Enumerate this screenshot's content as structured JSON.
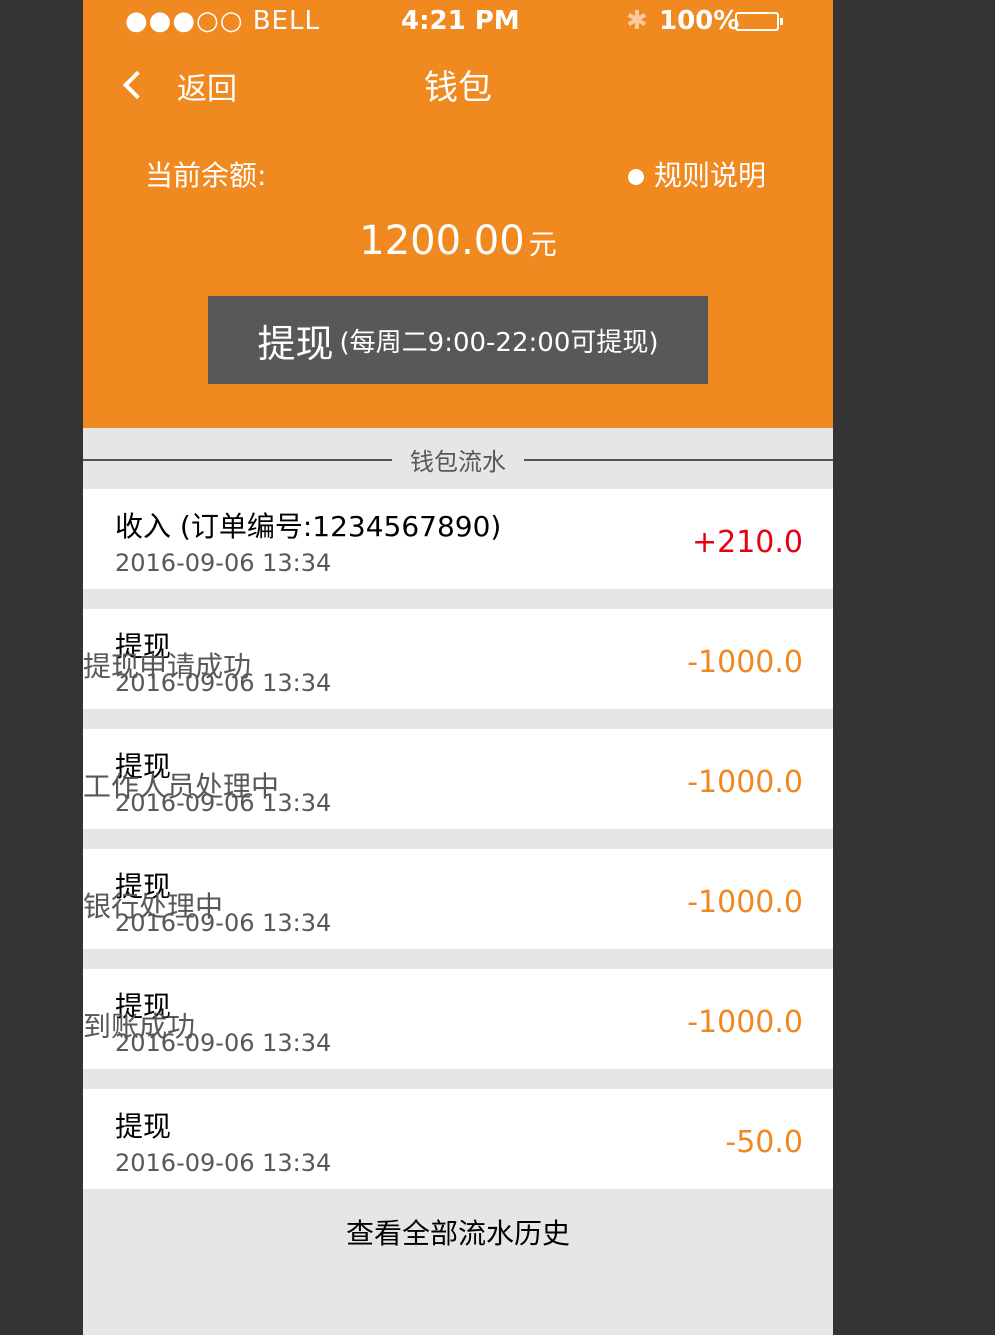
{
  "status_bar": {
    "carrier": "●●●○○ BELL",
    "time": "4:21 PM",
    "bluetooth": "✱",
    "battery": "100%"
  },
  "nav": {
    "back_label": "返回",
    "title": "钱包"
  },
  "balance": {
    "label": "当前余额:",
    "amount": "1200.00",
    "unit": "元",
    "rules_label": "规则说明"
  },
  "withdraw": {
    "label": "提现",
    "hint": "(每周二9:00-22:00可提现)"
  },
  "flow_title": "钱包流水",
  "records": [
    {
      "title": "收入 (订单编号:1234567890)",
      "time": "2016-09-06 13:34",
      "status": "",
      "amount": "+210.0",
      "color": "#e60012"
    },
    {
      "title": "提现",
      "time": "2016-09-06 13:34",
      "status": "提现申请成功",
      "amount": "-1000.0",
      "color": "#f08720"
    },
    {
      "title": "提现",
      "time": "2016-09-06 13:34",
      "status": "工作人员处理中",
      "amount": "-1000.0",
      "color": "#f08720"
    },
    {
      "title": "提现",
      "time": "2016-09-06 13:34",
      "status": "银行处理中",
      "amount": "-1000.0",
      "color": "#f08720"
    },
    {
      "title": "提现",
      "time": "2016-09-06 13:34",
      "status": "到账成功",
      "amount": "-1000.0",
      "color": "#f08720"
    },
    {
      "title": "提现",
      "time": "2016-09-06 13:34",
      "status": "",
      "amount": "-50.0",
      "color": "#f08720"
    }
  ],
  "view_all": "查看全部流水历史",
  "colors": {
    "header": "#f08920",
    "button": "#59575a",
    "income": "#e60012",
    "expense": "#f08720"
  }
}
